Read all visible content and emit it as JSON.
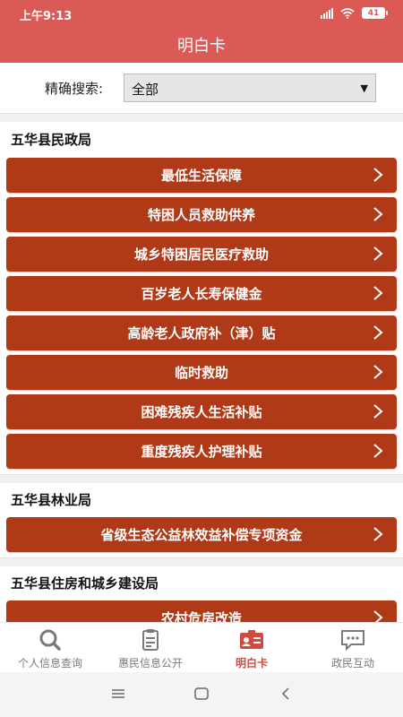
{
  "status_bar": {
    "time": "上午9:13",
    "battery": "41"
  },
  "header": {
    "title": "明白卡"
  },
  "search": {
    "label": "精确搜索:",
    "selected": "全部"
  },
  "sections": [
    {
      "title": "五华县民政局",
      "items": [
        "最低生活保障",
        "特困人员救助供养",
        "城乡特困居民医疗救助",
        "百岁老人长寿保健金",
        "高龄老人政府补（津）贴",
        "临时救助",
        "困难残疾人生活补贴",
        "重度残疾人护理补贴"
      ]
    },
    {
      "title": "五华县林业局",
      "items": [
        "省级生态公益林效益补偿专项资金"
      ]
    },
    {
      "title": "五华县住房和城乡建设局",
      "items": [
        "农村危房改造"
      ]
    }
  ],
  "bottom_nav": [
    {
      "label": "个人信息查询",
      "icon": "search-icon"
    },
    {
      "label": "惠民信息公开",
      "icon": "clipboard-icon"
    },
    {
      "label": "明白卡",
      "icon": "id-card-icon"
    },
    {
      "label": "政民互动",
      "icon": "chat-icon"
    }
  ],
  "colors": {
    "header": "#dc5a56",
    "item_button": "#b03a18",
    "active_tab": "#d04a40"
  }
}
